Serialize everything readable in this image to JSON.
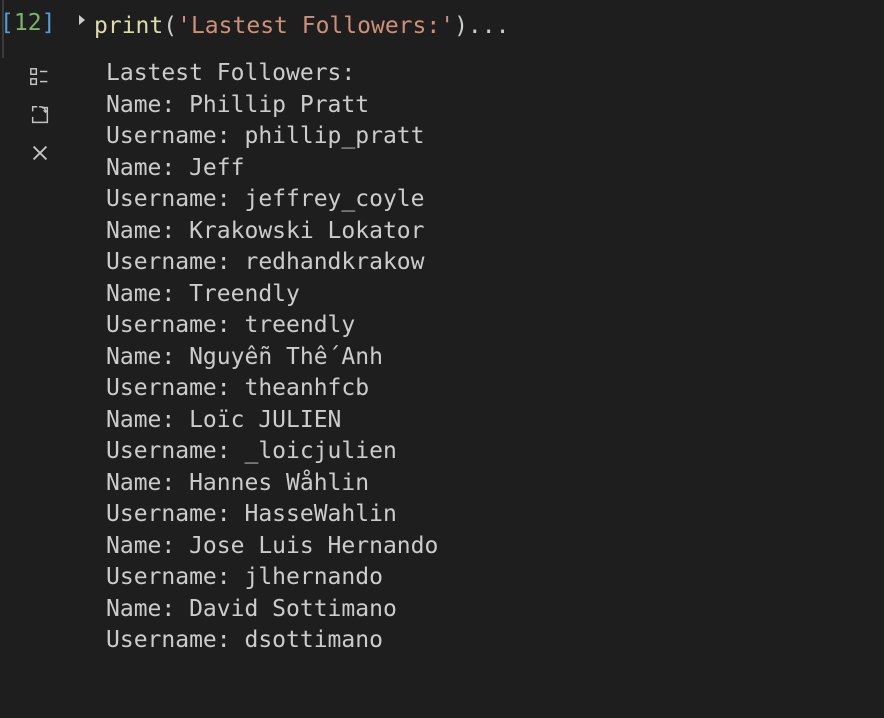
{
  "cell": {
    "execution_count": "12",
    "code": {
      "fn": "print",
      "open_paren": "(",
      "string": "'Lastest Followers:'",
      "close_paren": ")",
      "ellipsis": "..."
    }
  },
  "output": {
    "header": "Lastest Followers:",
    "lines": [
      "Name: Phillip Pratt",
      "Username: phillip_pratt",
      "Name: Jeff",
      "Username: jeffrey_coyle",
      "Name: Krakowski Lokator",
      "Username: redhandkrakow",
      "Name: Treendly",
      "Username: treendly",
      "Name: Nguyễn Thế Anh",
      "Username: theanhfcb",
      "Name: Loïc JULIEN",
      "Username: _loicjulien",
      "Name: Hannes Wåhlin",
      "Username: HasseWahlin",
      "Name: Jose Luis Hernando",
      "Username: jlhernando",
      "Name: David Sottimano",
      "Username: dsottimano"
    ]
  }
}
